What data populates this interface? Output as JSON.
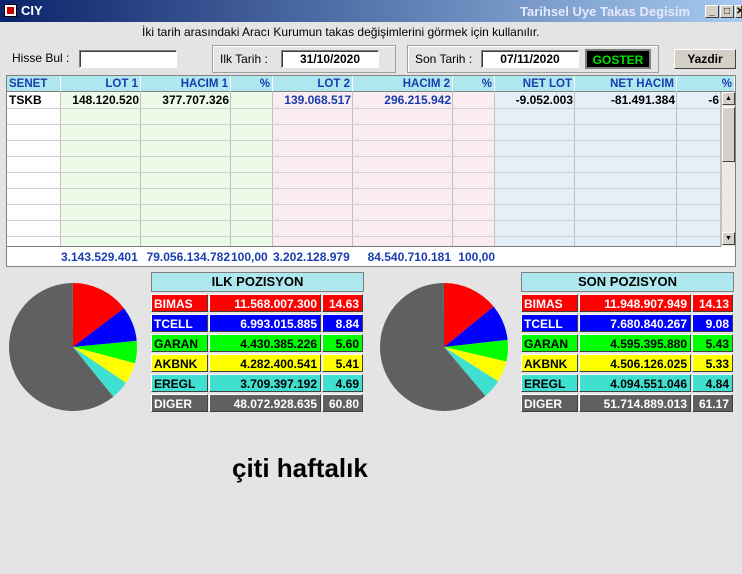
{
  "window": {
    "title": "CIY",
    "subtitle": "Tarihsel Uye Takas Degisim",
    "minimize_glyph": "_",
    "restore_glyph": "□",
    "close_glyph": "✕"
  },
  "info_text": "İki tarih arasındaki  Aracı Kurumun takas değişimlerini görmek için kullanılır.",
  "toolbar": {
    "hisse_label": "Hisse Bul :",
    "hisse_value": "",
    "ilk_tarih_label": "Ilk Tarih :",
    "ilk_tarih_value": "31/10/2020",
    "son_tarih_label": "Son Tarih :",
    "son_tarih_value": "07/11/2020",
    "goster_label": "GOSTER",
    "yazdir_label": "Yazdir"
  },
  "table": {
    "headers": [
      "SENET",
      "LOT 1",
      "HACIM 1",
      "%",
      "LOT 2",
      "HACIM 2",
      "%",
      "NET LOT",
      "NET HACIM",
      "%"
    ],
    "rows": [
      [
        "TSKB",
        "148.120.520",
        "377.707.326",
        "",
        "139.068.517",
        "296.215.942",
        "",
        "-9.052.003",
        "-81.491.384",
        "-6"
      ]
    ],
    "totals": [
      "",
      "3.143.529.401",
      "79.056.134.782",
      "100,00",
      "3.202.128.979",
      "84.540.710.181",
      "100,00",
      "",
      "",
      ""
    ]
  },
  "scrollbar": {
    "up_glyph": "▲",
    "down_glyph": "▼"
  },
  "ilk_pozisyon": {
    "title": "ILK POZISYON",
    "rows": [
      {
        "name": "BIMAS",
        "value": "11.568.007.300",
        "pct": "14.63",
        "color": "#ff0000",
        "text": "#ffffff"
      },
      {
        "name": "TCELL",
        "value": "6.993.015.885",
        "pct": "8.84",
        "color": "#0000ff",
        "text": "#ffffff"
      },
      {
        "name": "GARAN",
        "value": "4.430.385.226",
        "pct": "5.60",
        "color": "#00ff00",
        "text": "#000000"
      },
      {
        "name": "AKBNK",
        "value": "4.282.400.541",
        "pct": "5.41",
        "color": "#ffff00",
        "text": "#000000"
      },
      {
        "name": "EREGL",
        "value": "3.709.397.192",
        "pct": "4.69",
        "color": "#40e0d0",
        "text": "#000000"
      },
      {
        "name": "DIGER",
        "value": "48.072.928.635",
        "pct": "60.80",
        "color": "#606060",
        "text": "#ffffff"
      }
    ]
  },
  "son_pozisyon": {
    "title": "SON POZISYON",
    "rows": [
      {
        "name": "BIMAS",
        "value": "11.948.907.949",
        "pct": "14.13",
        "color": "#ff0000",
        "text": "#ffffff"
      },
      {
        "name": "TCELL",
        "value": "7.680.840.267",
        "pct": "9.08",
        "color": "#0000ff",
        "text": "#ffffff"
      },
      {
        "name": "GARAN",
        "value": "4.595.395.880",
        "pct": "5.43",
        "color": "#00ff00",
        "text": "#000000"
      },
      {
        "name": "AKBNK",
        "value": "4.506.126.025",
        "pct": "5.33",
        "color": "#ffff00",
        "text": "#000000"
      },
      {
        "name": "EREGL",
        "value": "4.094.551.046",
        "pct": "4.84",
        "color": "#40e0d0",
        "text": "#000000"
      },
      {
        "name": "DIGER",
        "value": "51.714.889.013",
        "pct": "61.17",
        "color": "#606060",
        "text": "#ffffff"
      }
    ]
  },
  "caption": "çiti haftalık"
}
